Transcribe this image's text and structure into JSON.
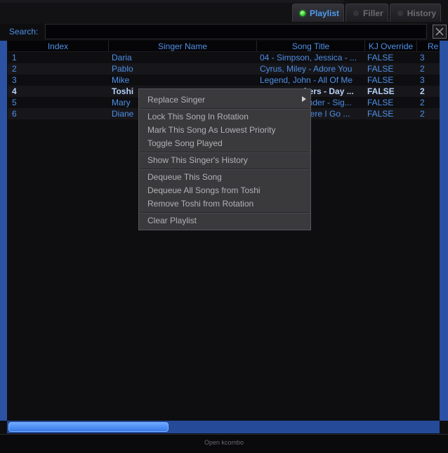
{
  "tabs": [
    {
      "label": "Playlist",
      "active": true
    },
    {
      "label": "Filler",
      "active": false
    },
    {
      "label": "History",
      "active": false
    }
  ],
  "search": {
    "label": "Search:",
    "value": "",
    "clear_icon": "close-icon"
  },
  "table": {
    "columns": [
      "Index",
      "Singer Name",
      "Song Title",
      "KJ Override",
      "Re"
    ],
    "rows": [
      {
        "index": "1",
        "singer": "Daria",
        "song": "04 - Simpson, Jessica - ...",
        "kj": "FALSE",
        "re": "3"
      },
      {
        "index": "2",
        "singer": "Pablo",
        "song": "Cyrus, Miley - Adore You",
        "kj": "FALSE",
        "re": "2"
      },
      {
        "index": "3",
        "singer": "Mike",
        "song": "Legend, John - All Of Me",
        "kj": "FALSE",
        "re": "3"
      },
      {
        "index": "4",
        "singer": "Toshi",
        "song": "kers - Day ...",
        "kj": "FALSE",
        "re": "2"
      },
      {
        "index": "5",
        "singer": "Mary",
        "song": "onder - Sig...",
        "kj": "FALSE",
        "re": "2"
      },
      {
        "index": "6",
        "singer": "Diane",
        "song": "Here I Go ...",
        "kj": "FALSE",
        "re": "2"
      }
    ]
  },
  "context_menu": {
    "replace_singer": "Replace Singer",
    "lock_song": "Lock This Song In Rotation",
    "mark_lowest": "Mark This Song As Lowest Priority",
    "toggle_played": "Toggle Song Played",
    "show_history": "Show This Singer's History",
    "dequeue_song": "Dequeue This Song",
    "dequeue_all": "Dequeue All Songs from Toshi",
    "remove_rotation": "Remove Toshi from Rotation",
    "clear_playlist": "Clear Playlist"
  },
  "status_text": "Open kcombo",
  "colors": {
    "accent": "#4f8fe6",
    "scroll": "#2b52a3",
    "led_on": "#2fd12f"
  }
}
